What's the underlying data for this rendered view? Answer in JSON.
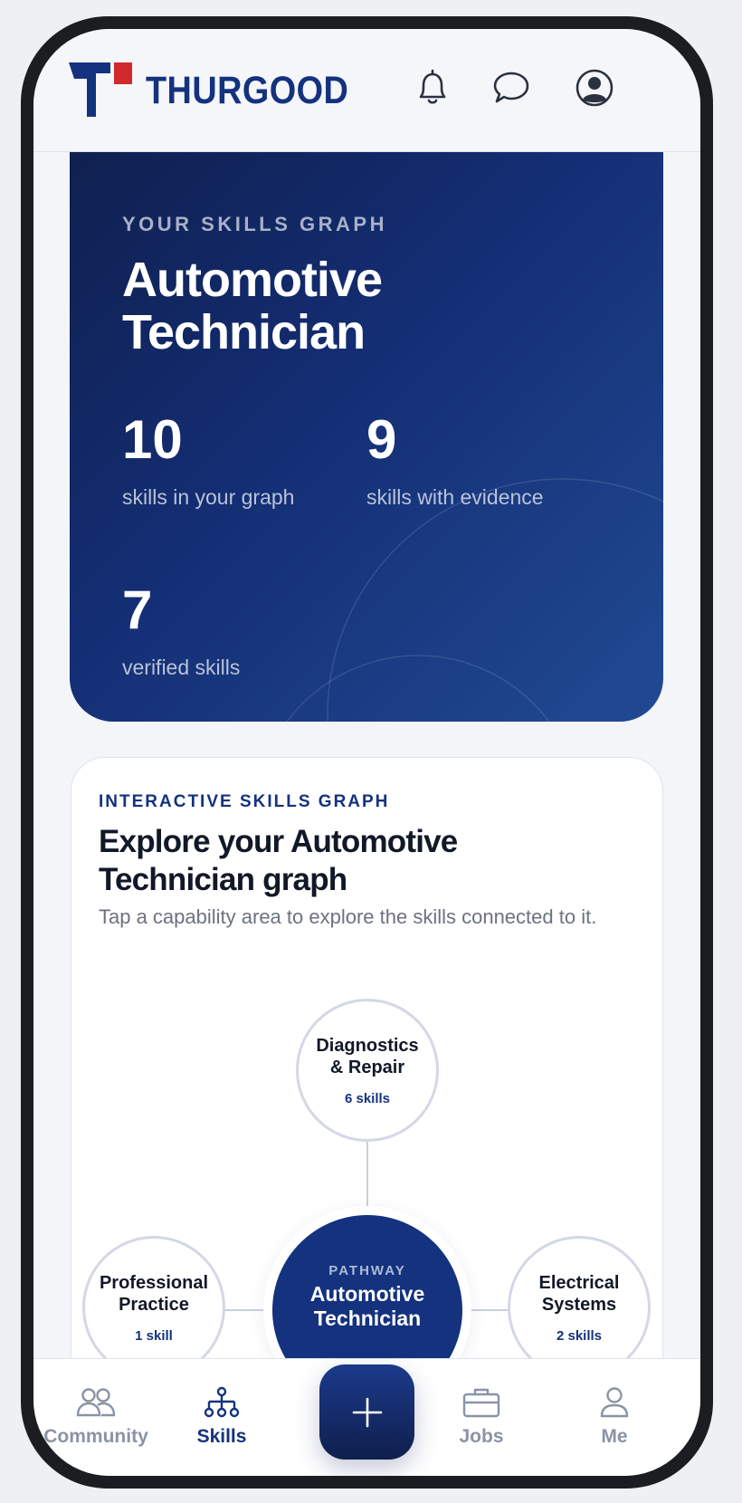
{
  "header": {
    "brand": "THURGOOD",
    "icons": [
      "bell-icon",
      "chat-bubble-icon",
      "profile-icon"
    ]
  },
  "hero": {
    "eyebrow": "YOUR SKILLS GRAPH",
    "title": "Automotive Technician",
    "stats": [
      {
        "value": "10",
        "label": "skills in your graph"
      },
      {
        "value": "9",
        "label": "skills with evidence"
      },
      {
        "value": "7",
        "label": "verified skills"
      }
    ]
  },
  "explore": {
    "eyebrow": "INTERACTIVE SKILLS GRAPH",
    "title": "Explore your Automotive Technician graph",
    "subtitle": "Tap a capability area to explore the skills connected to it.",
    "center": {
      "eyebrow": "PATHWAY",
      "name": "Automotive Technician"
    },
    "nodes": [
      {
        "name": "Diagnostics & Repair",
        "count": "6 skills"
      },
      {
        "name": "Professional Practice",
        "count": "1 skill"
      },
      {
        "name": "Electrical Systems",
        "count": "2 skills"
      }
    ]
  },
  "nav": {
    "items": [
      {
        "label": "Community",
        "icon": "people-icon"
      },
      {
        "label": "Skills",
        "icon": "hierarchy-icon"
      },
      {
        "label": "Jobs",
        "icon": "briefcase-icon"
      },
      {
        "label": "Me",
        "icon": "person-icon"
      }
    ],
    "fab_icon": "plus-icon",
    "active": "Skills"
  },
  "colors": {
    "brand_navy": "#14327e",
    "brand_red": "#d12a2a",
    "muted_text": "#6b7280",
    "nav_inactive": "#8a93a6"
  }
}
